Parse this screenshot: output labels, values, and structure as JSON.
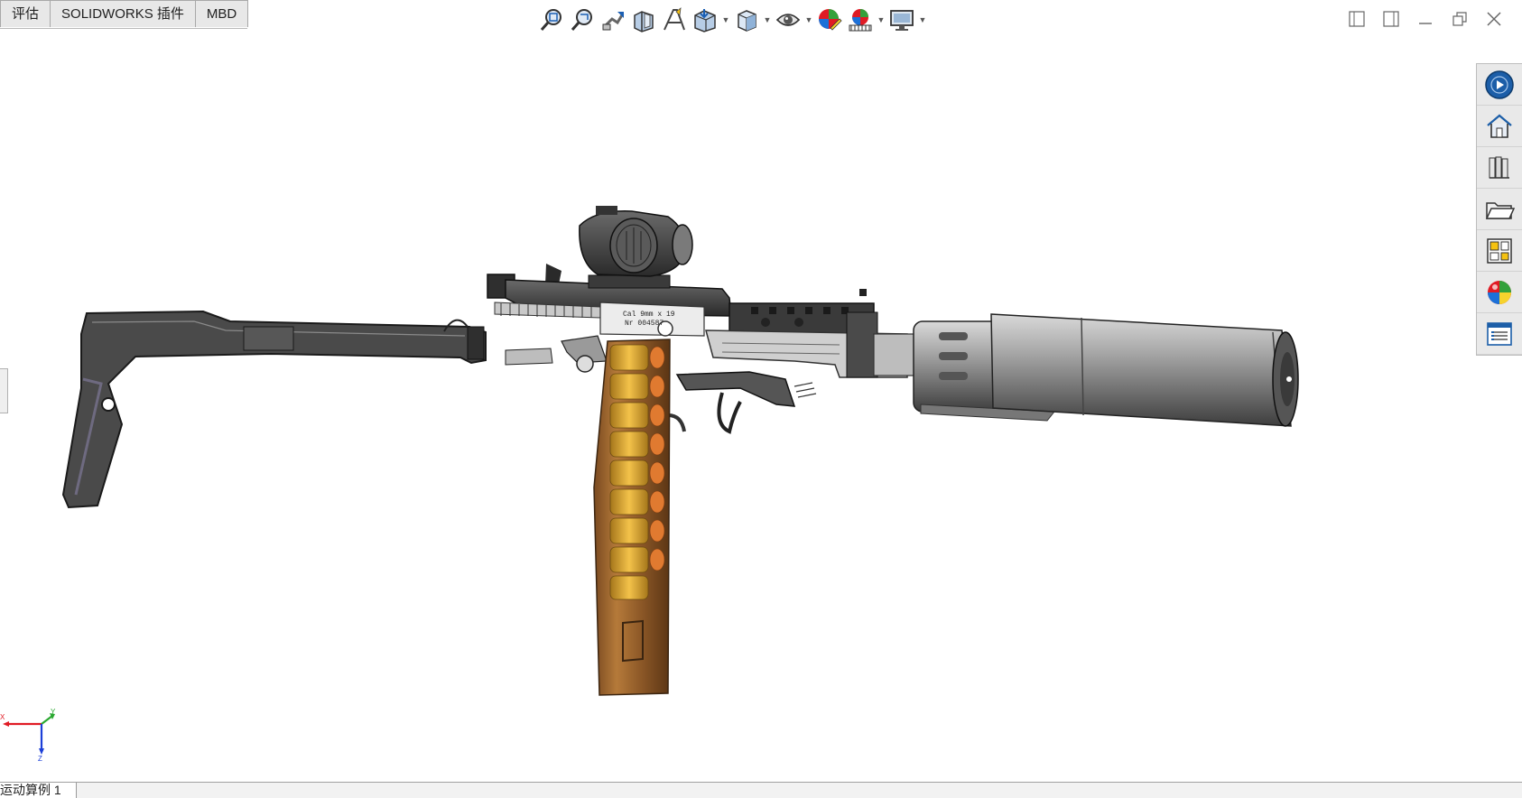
{
  "tabs": [
    {
      "label": "评估"
    },
    {
      "label": "SOLIDWORKS 插件"
    },
    {
      "label": "MBD"
    }
  ],
  "headsup_icons": [
    "zoom-to-fit-icon",
    "zoom-to-area-icon",
    "previous-view-icon",
    "section-view-icon",
    "dynamic-annotation-icon",
    "view-orientation-icon",
    "display-style-icon",
    "hide-show-items-icon",
    "edit-appearance-icon",
    "apply-scene-icon",
    "view-settings-icon"
  ],
  "task_pane_icons": [
    "solidworks-resources-icon",
    "home-icon",
    "design-library-icon",
    "file-explorer-icon",
    "view-palette-icon",
    "appearances-scenes-icon",
    "custom-properties-icon"
  ],
  "triad": {
    "x_label": "X",
    "y_label": "Y",
    "z_label": "Z"
  },
  "status_tab": {
    "label": "运动算例 1"
  }
}
